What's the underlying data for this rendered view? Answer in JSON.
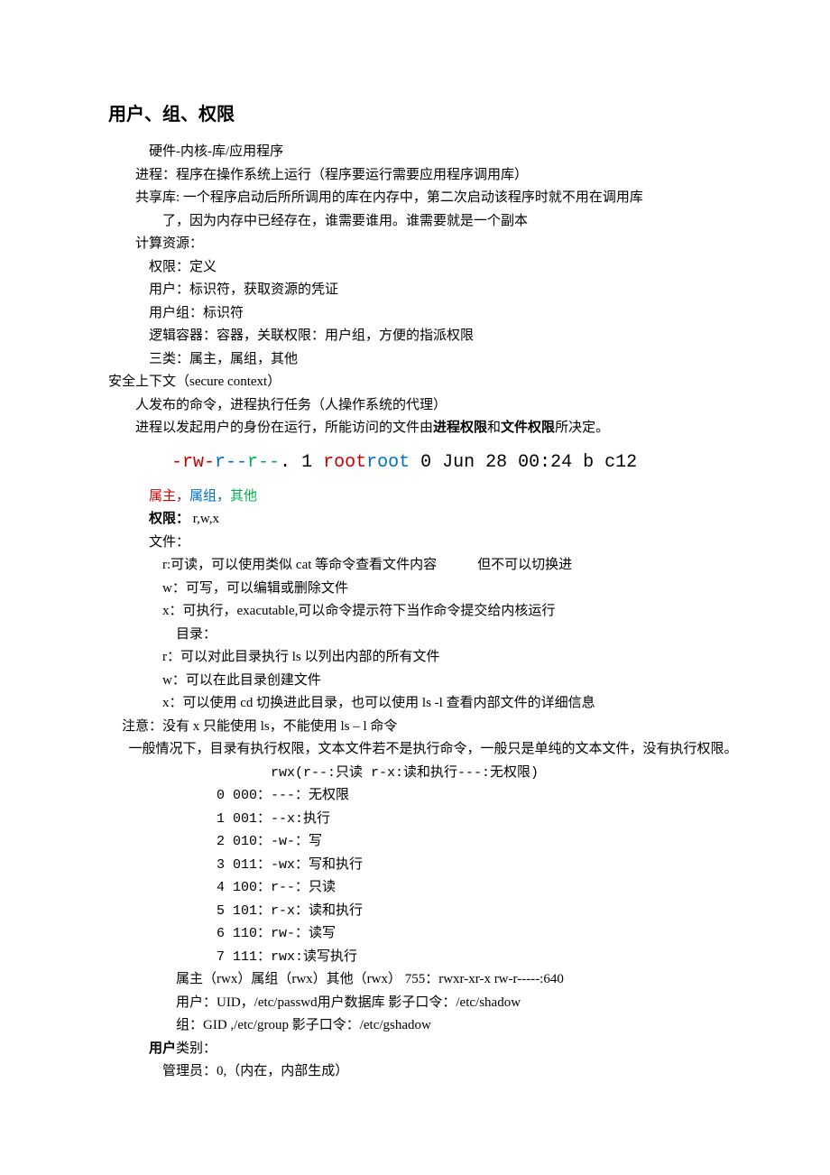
{
  "title": "用户、组、权限",
  "lines": {
    "l1": "硬件-内核-库/应用程序",
    "l2": "进程：程序在操作系统上运行（程序要运行需要应用程序调用库）",
    "l3a": "共享库: 一个程序启动后所所调用的库在内存中，第二次启动该程序时就不用在调用库",
    "l3b": "了，因为内存中已经存在，谁需要谁用。谁需要就是一个副本",
    "l4": "计算资源：",
    "l5": "权限：定义",
    "l6": "用户：标识符，获取资源的凭证",
    "l7": "用户组：标识符",
    "l8": "逻辑容器：容器，关联权限：用户组，方便的指派权限",
    "l9": "三类：属主，属组，其他",
    "l10": "安全上下文（secure context）",
    "l11": "人发布的命令，进程执行任务（人操作系统的代理）",
    "l12a": "进程以发起用户的身份在运行，所能访问的文件由",
    "l12b": "进程权限",
    "l12c": "和",
    "l12d": "文件权限",
    "l12e": "所决定。"
  },
  "ls": {
    "p1": "-",
    "p2": "rw-",
    "p3": "r--",
    "p4": "r--",
    "p5": ". 1 ",
    "p6": "root",
    "p7": "root",
    "p8": " 0 Jun 28 00:24 b c12"
  },
  "legend": {
    "a": "属主，",
    "b": "属组，",
    "c": "其他"
  },
  "perm": {
    "hdr_a": "权限：",
    "hdr_b": "   r,w,x",
    "file": "文件：",
    "r_file_a": "r:可读，可以使用类似 cat 等命令查看文件内容",
    "r_file_b": "但不可以切换进",
    "w_file": "w：可写，可以编辑或删除文件",
    "x_file": "x：可执行，exacutable,可以命令提示符下当作命令提交给内核运行",
    "dir": "目录：",
    "r_dir": "r：可以对此目录执行 ls 以列出内部的所有文件",
    "w_dir": "w：可以在此目录创建文件",
    "x_dir": "x：可以使用 cd 切换进此目录，也可以使用 ls -l 查看内部文件的详细信息",
    "note": "注意：没有 x 只能使用 ls，不能使用 ls – l 命令",
    "general": "一般情况下，目录有执行权限，文本文件若不是执行命令，一般只是单纯的文本文件，没有执行权限。"
  },
  "octal": {
    "hdr": "rwx(r--:只读 r-x:读和执行---:无权限)",
    "r0": "0   000：---：无权限",
    "r1": "1   001：--x:执行",
    "r2": "2   010：-w-：写",
    "r3": "3   011：-wx：写和执行",
    "r4": "4   100：r--：只读",
    "r5": "5   101：r-x：读和执行",
    "r6": "6   110：rw-：读写",
    "r7": "7   111：rwx:读写执行",
    "ex": "属主（rwx）属组（rwx）其他（rwx）   755：rwxr-xr-x     rw-r-----:640",
    "user": "用户：UID，/etc/passwd用户数据库    影子口令：/etc/shadow",
    "group": "组：GID ,/etc/group   影子口令：/etc/gshadow"
  },
  "ucat": {
    "hdr_a": "用户",
    "hdr_b": "类别：",
    "admin": "管理员：0,（内在，内部生成）"
  }
}
